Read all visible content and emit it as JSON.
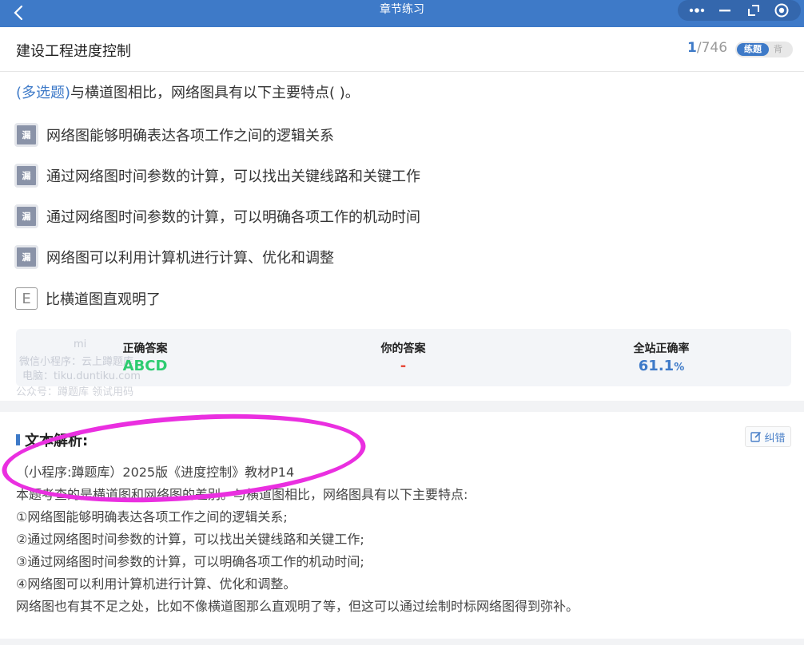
{
  "topbar": {
    "title": "章节练习"
  },
  "header": {
    "chapter_title": "建设工程进度控制",
    "progress_current": "1",
    "progress_total": "/746",
    "mode_on": "练题",
    "mode_off": "背"
  },
  "question": {
    "type": "(多选题)",
    "stem": "与横道图相比，网络图具有以下主要特点(        )。",
    "options": [
      {
        "icon": "漏",
        "text": "网络图能够明确表达各项工作之间的逻辑关系"
      },
      {
        "icon": "漏",
        "text": "通过网络图时间参数的计算，可以找出关键线路和关键工作"
      },
      {
        "icon": "漏",
        "text": "通过网络图时间参数的计算，可以明确各项工作的机动时间"
      },
      {
        "icon": "漏",
        "text": "网络图可以利用计算机进行计算、优化和调整"
      },
      {
        "icon": "E",
        "text": "比横道图直观明了"
      }
    ]
  },
  "stats": {
    "correct_label": "正确答案",
    "correct_value": "ABCD",
    "yours_label": "你的答案",
    "yours_value": "-",
    "rate_label": "全站正确率",
    "rate_value": "61.1",
    "rate_unit": "%"
  },
  "watermark": {
    "line0": "mi",
    "line1": "微信小程序：云上蹲题库",
    "line2": "电脑：tiku.duntiku.com",
    "line3": "公众号：蹲题库 领试用码"
  },
  "analysis": {
    "title": "文本解析:",
    "report": "纠错",
    "lines": [
      "（小程序:蹲题库）2025版《进度控制》教材P14",
      "本题考查的是横道图和网络图的差别。与横道图相比，网络图具有以下主要特点:",
      "①网络图能够明确表达各项工作之间的逻辑关系;",
      "②通过网络图时间参数的计算，可以找出关键线路和关键工作;",
      "③通过网络图时间参数的计算，可以明确各项工作的机动时间;",
      "④网络图可以利用计算机进行计算、优化和调整。",
      "网络图也有其不足之处，比如不像横道图那么直观明了等，但这可以通过绘制时标网络图得到弥补。"
    ]
  },
  "colors": {
    "accent": "#3e7ac8",
    "correct": "#2ecc71",
    "wrong": "#e74c3c",
    "annotation": "#ea2fe0"
  }
}
